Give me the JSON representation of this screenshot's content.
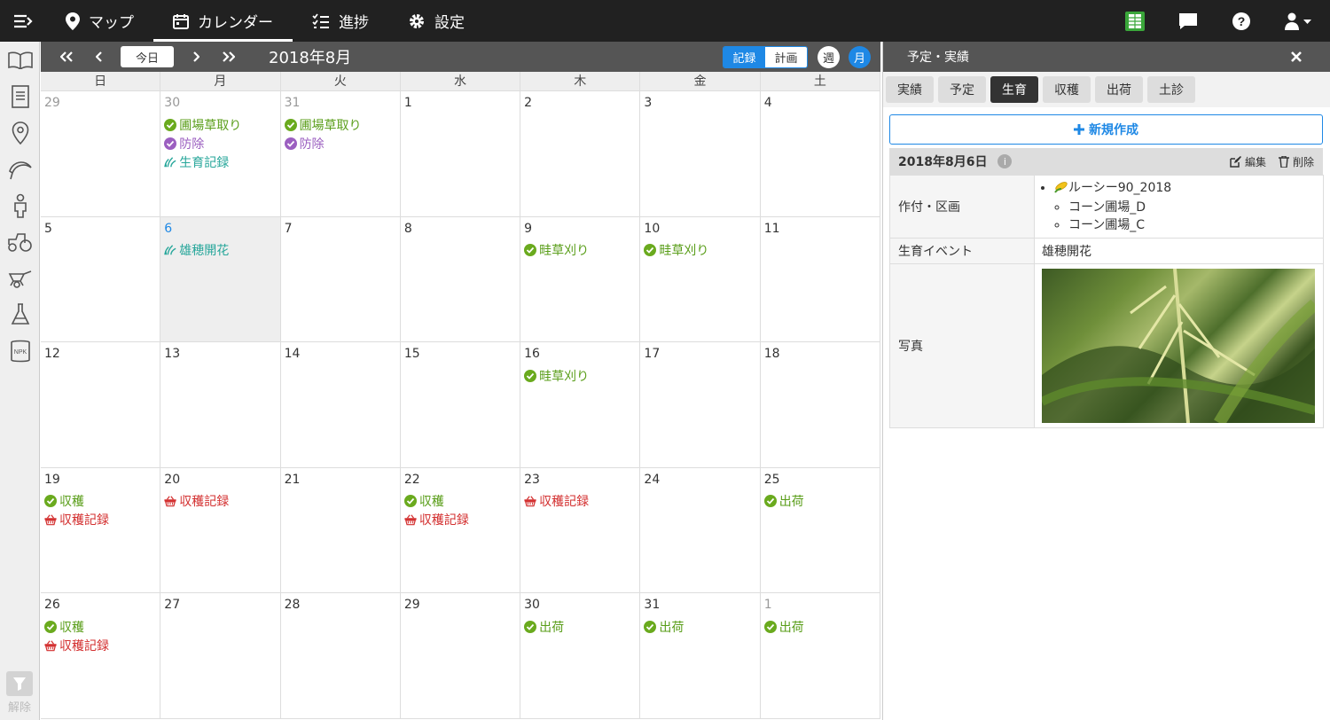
{
  "nav": {
    "tabs": [
      {
        "label": "マップ",
        "icon": "map-pin-icon"
      },
      {
        "label": "カレンダー",
        "icon": "calendar-icon"
      },
      {
        "label": "進捗",
        "icon": "checklist-icon"
      },
      {
        "label": "設定",
        "icon": "gear-icon"
      }
    ],
    "active_tab": "カレンダー"
  },
  "sidebar": {
    "items": [
      "book-icon",
      "document-icon",
      "location-icon",
      "sickle-icon",
      "worker-icon",
      "tractor-icon",
      "wheelbarrow-icon",
      "flask-icon",
      "npk-fertilizer-icon"
    ],
    "npk_label": "NPK",
    "filter_label": "解除"
  },
  "toolbar": {
    "today_label": "今日",
    "month_title": "2018年8月",
    "view_toggle": [
      "記録",
      "計画"
    ],
    "view_active": "記録",
    "week_label": "週",
    "month_label": "月"
  },
  "calendar": {
    "weekdays": [
      "日",
      "月",
      "火",
      "水",
      "木",
      "金",
      "土"
    ],
    "weeks": [
      [
        {
          "num": "29",
          "other": true,
          "events": []
        },
        {
          "num": "30",
          "other": true,
          "events": [
            {
              "type": "check-green",
              "text": "圃場草取り"
            },
            {
              "type": "check-purple",
              "text": "防除"
            },
            {
              "type": "growth",
              "text": "生育記録"
            }
          ]
        },
        {
          "num": "31",
          "other": true,
          "events": [
            {
              "type": "check-green",
              "text": "圃場草取り"
            },
            {
              "type": "check-purple",
              "text": "防除"
            }
          ]
        },
        {
          "num": "1",
          "events": []
        },
        {
          "num": "2",
          "events": []
        },
        {
          "num": "3",
          "events": []
        },
        {
          "num": "4",
          "events": []
        }
      ],
      [
        {
          "num": "5",
          "events": []
        },
        {
          "num": "6",
          "today": true,
          "selected": true,
          "events": [
            {
              "type": "growth",
              "text": "雄穂開花"
            }
          ]
        },
        {
          "num": "7",
          "events": []
        },
        {
          "num": "8",
          "events": []
        },
        {
          "num": "9",
          "events": [
            {
              "type": "check-green",
              "text": "畦草刈り"
            }
          ]
        },
        {
          "num": "10",
          "events": [
            {
              "type": "check-green",
              "text": "畦草刈り"
            }
          ]
        },
        {
          "num": "11",
          "events": []
        }
      ],
      [
        {
          "num": "12",
          "events": []
        },
        {
          "num": "13",
          "events": []
        },
        {
          "num": "14",
          "events": []
        },
        {
          "num": "15",
          "events": []
        },
        {
          "num": "16",
          "events": [
            {
              "type": "check-green",
              "text": "畦草刈り"
            }
          ]
        },
        {
          "num": "17",
          "events": []
        },
        {
          "num": "18",
          "events": []
        }
      ],
      [
        {
          "num": "19",
          "events": [
            {
              "type": "check-green",
              "text": "収穫"
            },
            {
              "type": "basket-red",
              "text": "収穫記録"
            }
          ]
        },
        {
          "num": "20",
          "events": [
            {
              "type": "basket-red",
              "text": "収穫記録"
            }
          ]
        },
        {
          "num": "21",
          "events": []
        },
        {
          "num": "22",
          "events": [
            {
              "type": "check-green",
              "text": "収穫"
            },
            {
              "type": "basket-red",
              "text": "収穫記録"
            }
          ]
        },
        {
          "num": "23",
          "events": [
            {
              "type": "basket-red",
              "text": "収穫記録"
            }
          ]
        },
        {
          "num": "24",
          "events": []
        },
        {
          "num": "25",
          "events": [
            {
              "type": "check-green",
              "text": "出荷"
            }
          ]
        }
      ],
      [
        {
          "num": "26",
          "events": [
            {
              "type": "check-green",
              "text": "収穫"
            },
            {
              "type": "basket-red",
              "text": "収穫記録"
            }
          ]
        },
        {
          "num": "27",
          "events": []
        },
        {
          "num": "28",
          "events": []
        },
        {
          "num": "29",
          "events": []
        },
        {
          "num": "30",
          "events": [
            {
              "type": "check-green",
              "text": "出荷"
            }
          ]
        },
        {
          "num": "31",
          "events": [
            {
              "type": "check-green",
              "text": "出荷"
            }
          ]
        },
        {
          "num": "1",
          "other": true,
          "events": [
            {
              "type": "check-green",
              "text": "出荷"
            }
          ]
        }
      ]
    ]
  },
  "panel": {
    "title": "予定・実績",
    "tabs": [
      "実績",
      "予定",
      "生育",
      "収穫",
      "出荷",
      "土診"
    ],
    "active_tab": "生育",
    "new_button": "新規作成",
    "record": {
      "date": "2018年8月6日",
      "edit_label": "編集",
      "delete_label": "削除",
      "crop_key": "作付・区画",
      "crop_name": "ルーシー90_2018",
      "fields": [
        "コーン圃場_D",
        "コーン圃場_C"
      ],
      "event_key": "生育イベント",
      "event_value": "雄穂開花",
      "photo_key": "写真"
    }
  },
  "colors": {
    "topbar": "#212121",
    "accent": "#1e88e5",
    "event_green": "#5a9e1a",
    "event_purple": "#9b5fc0",
    "event_teal": "#26a69a",
    "event_red": "#d32f2f"
  }
}
